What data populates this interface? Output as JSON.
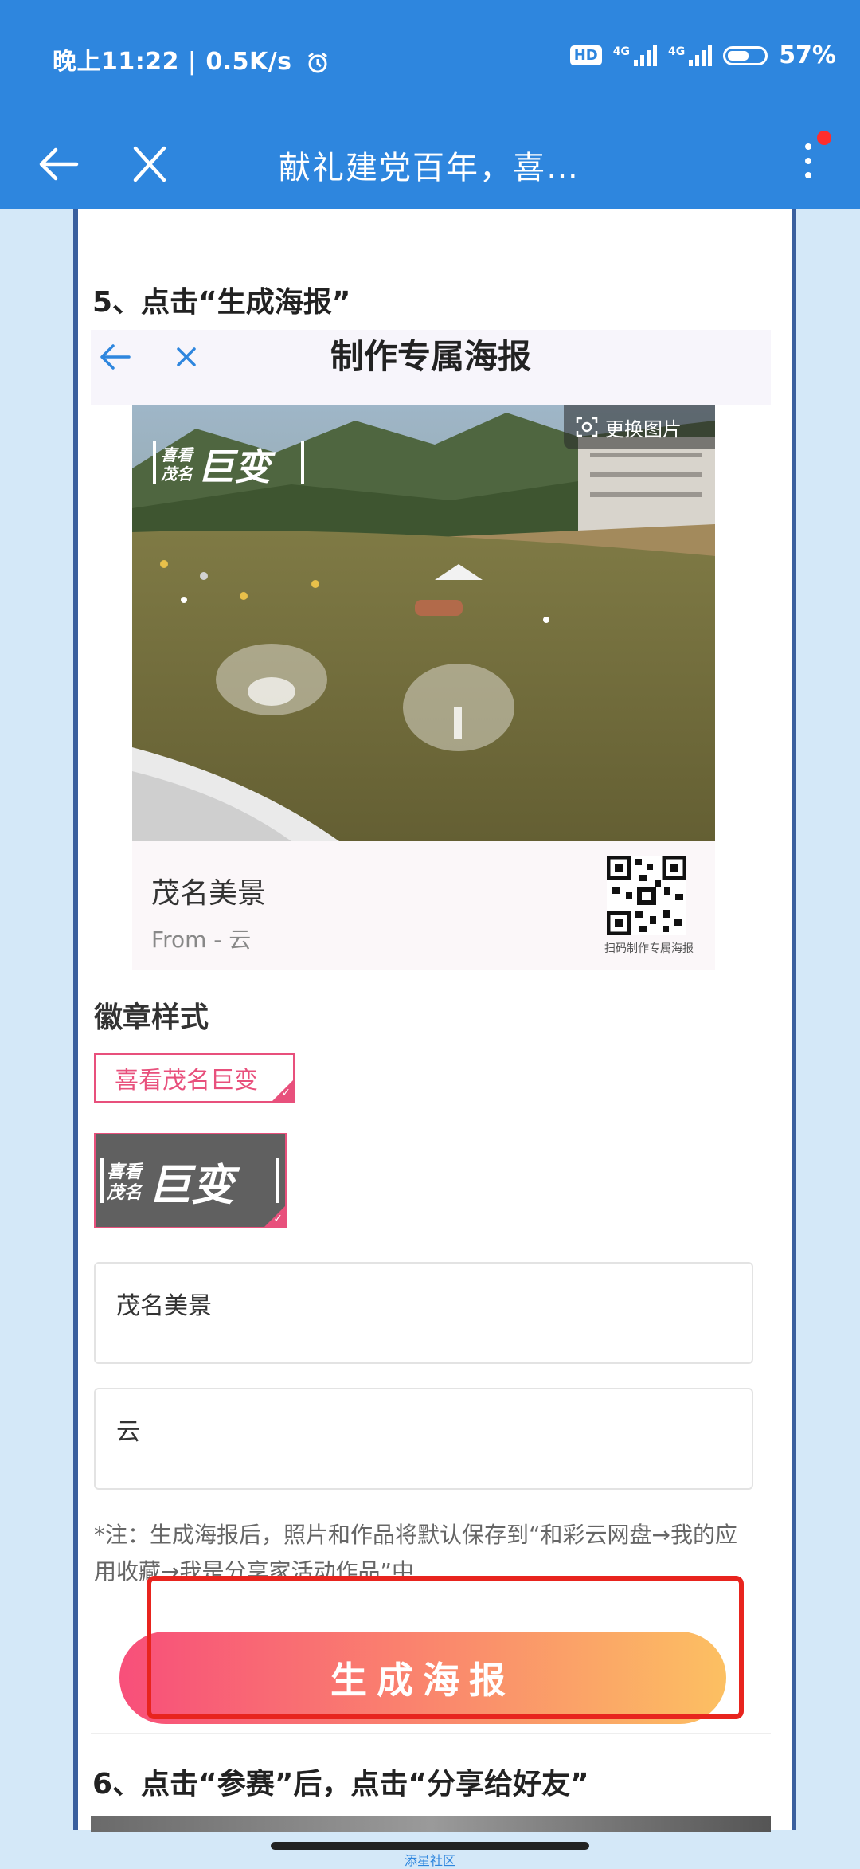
{
  "status_bar": {
    "time_speed": "晚上11:22 | 0.5K/s",
    "hd_badge": "HD",
    "signal1_label": "4G",
    "signal2_label": "4G",
    "battery": "57%"
  },
  "title_bar": {
    "title": "献礼建党百年，喜…"
  },
  "article": {
    "step5": "5、点击“生成海报”",
    "step6": "6、点击“参赛”后，点击“分享给好友”",
    "watermark": "添星社区"
  },
  "poster_editor": {
    "header_title": "制作专属海报",
    "change_image_label": "更换图片",
    "badge_text_line1": "喜看",
    "badge_text_line2": "茂名",
    "badge_text_big": "巨变",
    "poster_title": "茂名美景",
    "poster_from": "From - 云",
    "qr_caption": "扫码制作专属海报",
    "badge_section_label": "徽章样式",
    "badge_option1": "喜看茂名巨变",
    "title_input_value": "茂名美景",
    "author_input_value": "云",
    "note": "*注：生成海报后，照片和作品将默认保存到“和彩云网盘→我的应用收藏→我是分享家活动作品”中",
    "generate_button": "生成海报"
  },
  "colors": {
    "brand_blue": "#2e86de",
    "accent_pink": "#e8507c",
    "highlight_red": "#e8241e"
  }
}
